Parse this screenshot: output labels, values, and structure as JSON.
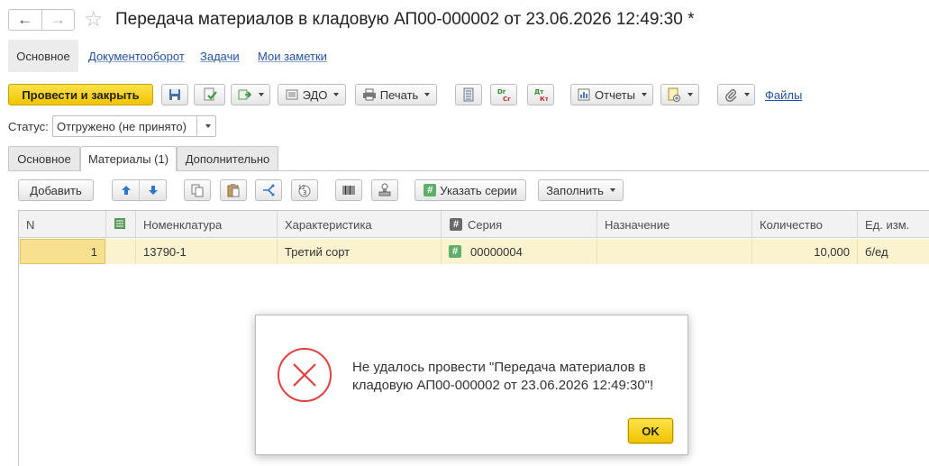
{
  "header": {
    "back_label": "←",
    "forward_label": "→",
    "star_label": "☆",
    "title": "Передача материалов в кладовую АП00-000002 от 23.06.2026 12:49:30 *"
  },
  "sections": {
    "main": "Основное",
    "docflow": "Документооборот",
    "tasks": "Задачи",
    "notes": "Мои заметки"
  },
  "toolbar": {
    "post_close": "Провести и закрыть",
    "edo": "ЭДО",
    "print": "Печать",
    "reports": "Отчеты",
    "files": "Файлы"
  },
  "status": {
    "label": "Статус:",
    "value": "Отгружено (не принято)"
  },
  "tabs": {
    "main": "Основное",
    "materials": "Материалы (1)",
    "extra": "Дополнительно"
  },
  "table_toolbar": {
    "add": "Добавить",
    "specify_series": "Указать серии",
    "fill": "Заполнить"
  },
  "table": {
    "columns": {
      "n": "N",
      "nomenclature": "Номенклатура",
      "characteristic": "Характеристика",
      "series": "Серия",
      "purpose": "Назначение",
      "quantity": "Количество",
      "unit": "Ед. изм."
    },
    "rows": [
      {
        "n": "1",
        "nomenclature": "13790-1",
        "characteristic": "Третий сорт",
        "series": "00000004",
        "purpose": "",
        "quantity": "10,000",
        "unit": "б/ед"
      }
    ]
  },
  "dialog": {
    "message": "Не удалось провести \"Передача материалов в кладовую АП00-000002 от 23.06.2026 12:49:30\"!",
    "ok": "OK"
  },
  "colors": {
    "accent_yellow": "#f2c400",
    "link_blue": "#2451a3",
    "error_red": "#e04040",
    "series_green": "#5fae6a"
  }
}
